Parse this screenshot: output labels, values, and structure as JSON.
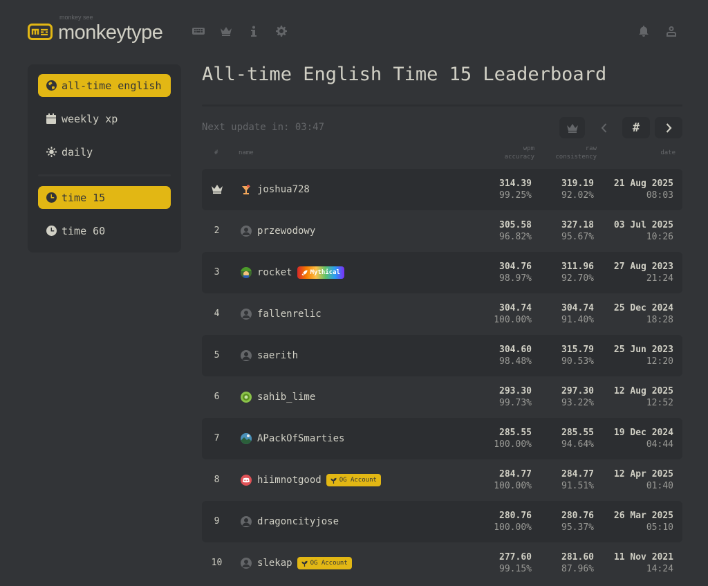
{
  "header": {
    "logo_top": "monkey see",
    "logo_main": "monkeytype",
    "nav_icons": [
      "keyboard-icon",
      "crown-icon",
      "info-icon",
      "gear-icon"
    ],
    "right_icons": [
      "bell-icon",
      "user-icon"
    ]
  },
  "sidebar": {
    "items": [
      {
        "label": "all-time english",
        "icon": "globe-icon",
        "active": true
      },
      {
        "label": "weekly xp",
        "icon": "calendar-icon",
        "active": false
      },
      {
        "label": "daily",
        "icon": "sun-icon",
        "active": false
      },
      {
        "label": "time 15",
        "icon": "clock-icon",
        "active": true
      },
      {
        "label": "time 60",
        "icon": "clock-icon",
        "active": false
      }
    ]
  },
  "main": {
    "title": "All-time English Time 15 Leaderboard",
    "next_update": "Next update in: 03:47",
    "controls": [
      "crown-icon",
      "chevron-left-icon",
      "#",
      "chevron-right-icon"
    ],
    "columns": {
      "rank": "#",
      "name": "name",
      "wpm": "wpm",
      "accuracy": "accuracy",
      "raw": "raw",
      "consistency": "consistency",
      "date": "date"
    }
  },
  "rows": [
    {
      "rank": "",
      "rank_icon": "crown-icon",
      "name": "joshua728",
      "avatar": "cocktail-icon",
      "badge": "",
      "wpm": "314.39",
      "acc": "99.25%",
      "raw": "319.19",
      "cons": "92.02%",
      "date": "21 Aug 2025",
      "time": "08:03"
    },
    {
      "rank": "2",
      "name": "przewodowy",
      "avatar": "default-user-icon",
      "badge": "",
      "wpm": "305.58",
      "acc": "96.82%",
      "raw": "327.18",
      "cons": "95.67%",
      "date": "03 Jul 2025",
      "time": "10:26"
    },
    {
      "rank": "3",
      "name": "rocket",
      "avatar": "character-avatar",
      "badge": "Mythical",
      "badge_type": "mythical",
      "wpm": "304.76",
      "acc": "98.97%",
      "raw": "311.96",
      "cons": "92.70%",
      "date": "27 Aug 2023",
      "time": "21:24"
    },
    {
      "rank": "4",
      "name": "fallenrelic",
      "avatar": "default-user-icon",
      "badge": "",
      "wpm": "304.74",
      "acc": "100.00%",
      "raw": "304.74",
      "cons": "91.40%",
      "date": "25 Dec 2024",
      "time": "18:28"
    },
    {
      "rank": "5",
      "name": "saerith",
      "avatar": "default-user-icon",
      "badge": "",
      "wpm": "304.60",
      "acc": "98.48%",
      "raw": "315.79",
      "cons": "90.53%",
      "date": "25 Jun 2023",
      "time": "12:20"
    },
    {
      "rank": "6",
      "name": "sahib_lime",
      "avatar": "lime-avatar",
      "badge": "",
      "wpm": "293.30",
      "acc": "99.73%",
      "raw": "297.30",
      "cons": "93.22%",
      "date": "12 Aug 2025",
      "time": "12:52"
    },
    {
      "rank": "7",
      "name": "APackOfSmarties",
      "avatar": "picture-avatar",
      "badge": "",
      "wpm": "285.55",
      "acc": "100.00%",
      "raw": "285.55",
      "cons": "94.64%",
      "date": "19 Dec 2024",
      "time": "04:44"
    },
    {
      "rank": "8",
      "name": "hiimnotgood",
      "avatar": "discord-avatar",
      "badge": "OG Account",
      "badge_type": "og",
      "wpm": "284.77",
      "acc": "100.00%",
      "raw": "284.77",
      "cons": "91.51%",
      "date": "12 Apr 2025",
      "time": "01:40"
    },
    {
      "rank": "9",
      "name": "dragoncityjose",
      "avatar": "default-user-icon",
      "badge": "",
      "wpm": "280.76",
      "acc": "100.00%",
      "raw": "280.76",
      "cons": "95.37%",
      "date": "26 Mar 2025",
      "time": "05:10"
    },
    {
      "rank": "10",
      "name": "slekap",
      "avatar": "default-user-icon",
      "badge": "OG Account",
      "badge_type": "og",
      "wpm": "277.60",
      "acc": "99.15%",
      "raw": "281.60",
      "cons": "87.96%",
      "date": "11 Nov 2021",
      "time": "14:24"
    }
  ],
  "colors": {
    "background": "#323437",
    "panel": "#2c2e31",
    "accent": "#e2b714",
    "text": "#d1d0c5",
    "subtext": "#646669"
  }
}
